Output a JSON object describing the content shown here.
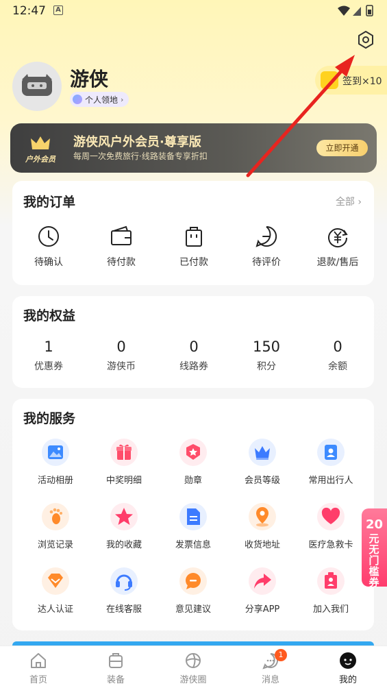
{
  "status_bar": {
    "time": "12:47",
    "notif_glyph": "A"
  },
  "profile": {
    "name": "游侠",
    "territory": "个人领地",
    "checkin": "签到×10"
  },
  "vip": {
    "badge": "户外会员",
    "title": "游侠风户外会员·尊享版",
    "subtitle": "每周一次免费旅行·线路装备专享折扣",
    "button": "立即开通"
  },
  "orders": {
    "title": "我的订单",
    "more": "全部",
    "items": [
      {
        "label": "待确认",
        "icon": "clock-icon"
      },
      {
        "label": "待付款",
        "icon": "wallet-icon"
      },
      {
        "label": "已付款",
        "icon": "bag-icon"
      },
      {
        "label": "待评价",
        "icon": "comment-icon"
      },
      {
        "label": "退款/售后",
        "icon": "refund-icon"
      }
    ]
  },
  "benefits": {
    "title": "我的权益",
    "items": [
      {
        "value": "1",
        "label": "优惠券"
      },
      {
        "value": "0",
        "label": "游侠币"
      },
      {
        "value": "0",
        "label": "线路券"
      },
      {
        "value": "150",
        "label": "积分"
      },
      {
        "value": "0",
        "label": "余额"
      }
    ]
  },
  "services": {
    "title": "我的服务",
    "items": [
      {
        "label": "活动相册",
        "icon": "photo-album-icon",
        "color": "#3d8bff"
      },
      {
        "label": "中奖明细",
        "icon": "gift-icon",
        "color": "#ff4d6a"
      },
      {
        "label": "勋章",
        "icon": "medal-icon",
        "color": "#ff4d6a"
      },
      {
        "label": "会员等级",
        "icon": "crown-icon",
        "color": "#3d7bff"
      },
      {
        "label": "常用出行人",
        "icon": "traveler-icon",
        "color": "#3d8bff"
      },
      {
        "label": "浏览记录",
        "icon": "footprint-icon",
        "color": "#ff8a2a"
      },
      {
        "label": "我的收藏",
        "icon": "star-icon",
        "color": "#ff3d6a"
      },
      {
        "label": "发票信息",
        "icon": "invoice-icon",
        "color": "#3d7bff"
      },
      {
        "label": "收货地址",
        "icon": "location-icon",
        "color": "#ff8a2a"
      },
      {
        "label": "医疗急救卡",
        "icon": "heart-icon",
        "color": "#ff3d6a"
      },
      {
        "label": "达人认证",
        "icon": "diamond-icon",
        "color": "#ff8a2a"
      },
      {
        "label": "在线客服",
        "icon": "headset-icon",
        "color": "#3d7bff"
      },
      {
        "label": "意见建议",
        "icon": "feedback-icon",
        "color": "#ff8a2a"
      },
      {
        "label": "分享APP",
        "icon": "share-icon",
        "color": "#ff3d6a"
      },
      {
        "label": "加入我们",
        "icon": "join-icon",
        "color": "#ff3d6a"
      }
    ]
  },
  "side_promo": {
    "num": "20",
    "text": "元无门槛券"
  },
  "tabbar": {
    "items": [
      {
        "label": "首页",
        "icon": "home-icon"
      },
      {
        "label": "装备",
        "icon": "gear-bag-icon"
      },
      {
        "label": "游侠圈",
        "icon": "community-icon"
      },
      {
        "label": "消息",
        "icon": "message-icon",
        "badge": "1"
      },
      {
        "label": "我的",
        "icon": "profile-icon",
        "active": true
      }
    ]
  },
  "colors": {
    "accent": "#ffd21f",
    "arrow": "#e8241f",
    "badge": "#ff5a1f"
  }
}
